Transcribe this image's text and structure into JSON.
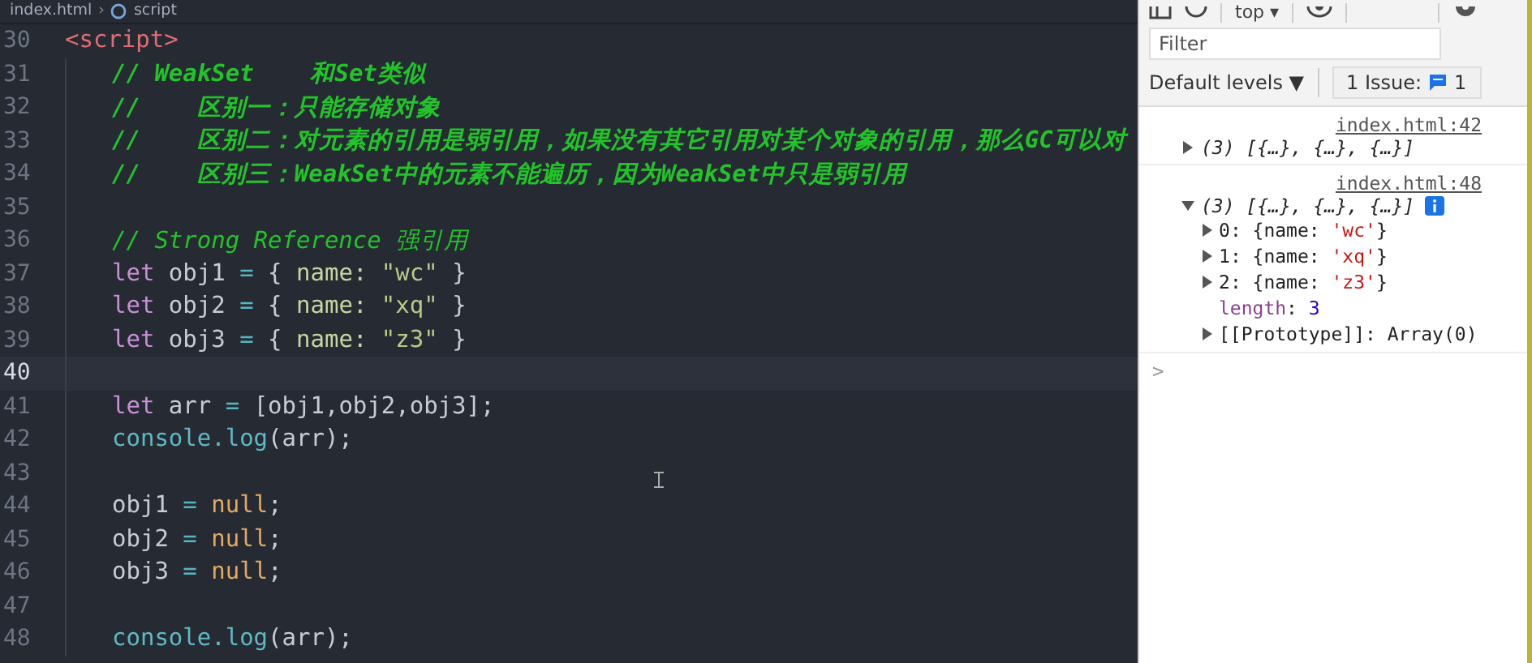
{
  "editor": {
    "breadcrumb": [
      "index.html",
      "script"
    ],
    "breadcrumb_separator": "›",
    "lines": [
      {
        "number": "30",
        "current": false,
        "indented": false,
        "tokens": [
          {
            "kind": "tag",
            "text": "<script>"
          }
        ]
      },
      {
        "number": "31",
        "current": false,
        "indented": true,
        "tokens": [
          {
            "kind": "comment",
            "text": "// WeakSet    和Set类似"
          }
        ]
      },
      {
        "number": "32",
        "current": false,
        "indented": true,
        "tokens": [
          {
            "kind": "comment",
            "text": "//    区别一：只能存储对象"
          }
        ]
      },
      {
        "number": "33",
        "current": false,
        "indented": true,
        "tokens": [
          {
            "kind": "comment",
            "text": "//    区别二：对元素的引用是弱引用，如果没有其它引用对某个对象的引用，那么GC可以对"
          }
        ]
      },
      {
        "number": "34",
        "current": false,
        "indented": true,
        "tokens": [
          {
            "kind": "comment",
            "text": "//    区别三：WeakSet中的元素不能遍历，因为WeakSet中只是弱引用"
          }
        ]
      },
      {
        "number": "35",
        "current": false,
        "indented": true
      },
      {
        "number": "36",
        "current": false,
        "indented": true,
        "tokens": [
          {
            "kind": "comment-italic",
            "text": "// Strong Reference 强引用"
          }
        ]
      },
      {
        "number": "37",
        "current": false,
        "indented": true,
        "tokens": [
          {
            "kind": "keyword",
            "text": "let"
          },
          {
            "kind": "plain",
            "text": " obj1 "
          },
          {
            "kind": "operator",
            "text": "="
          },
          {
            "kind": "plain",
            "text": " { "
          },
          {
            "kind": "property",
            "text": "name: "
          },
          {
            "kind": "string",
            "text": "\"wc\""
          },
          {
            "kind": "plain",
            "text": " }"
          }
        ]
      },
      {
        "number": "38",
        "current": false,
        "indented": true,
        "tokens": [
          {
            "kind": "keyword",
            "text": "let"
          },
          {
            "kind": "plain",
            "text": " obj2 "
          },
          {
            "kind": "operator",
            "text": "="
          },
          {
            "kind": "plain",
            "text": " { "
          },
          {
            "kind": "property",
            "text": "name: "
          },
          {
            "kind": "string",
            "text": "\"xq\""
          },
          {
            "kind": "plain",
            "text": " }"
          }
        ]
      },
      {
        "number": "39",
        "current": false,
        "indented": true,
        "tokens": [
          {
            "kind": "keyword",
            "text": "let"
          },
          {
            "kind": "plain",
            "text": " obj3 "
          },
          {
            "kind": "operator",
            "text": "="
          },
          {
            "kind": "plain",
            "text": " { "
          },
          {
            "kind": "property",
            "text": "name: "
          },
          {
            "kind": "string",
            "text": "\"z3\""
          },
          {
            "kind": "plain",
            "text": " }"
          }
        ]
      },
      {
        "number": "40",
        "current": true,
        "indented": true
      },
      {
        "number": "41",
        "current": false,
        "indented": true,
        "tokens": [
          {
            "kind": "keyword",
            "text": "let"
          },
          {
            "kind": "plain",
            "text": " arr "
          },
          {
            "kind": "operator",
            "text": "="
          },
          {
            "kind": "plain",
            "text": " [obj1,obj2,obj3];"
          }
        ]
      },
      {
        "number": "42",
        "current": false,
        "indented": true,
        "tokens": [
          {
            "kind": "function",
            "text": "console.log"
          },
          {
            "kind": "plain",
            "text": "(arr);"
          }
        ]
      },
      {
        "number": "43",
        "current": false,
        "indented": true
      },
      {
        "number": "44",
        "current": false,
        "indented": true,
        "tokens": [
          {
            "kind": "plain",
            "text": "obj1 "
          },
          {
            "kind": "operator",
            "text": "= "
          },
          {
            "kind": "null",
            "text": "null"
          },
          {
            "kind": "plain",
            "text": ";"
          }
        ]
      },
      {
        "number": "45",
        "current": false,
        "indented": true,
        "tokens": [
          {
            "kind": "plain",
            "text": "obj2 "
          },
          {
            "kind": "operator",
            "text": "= "
          },
          {
            "kind": "null",
            "text": "null"
          },
          {
            "kind": "plain",
            "text": ";"
          }
        ]
      },
      {
        "number": "46",
        "current": false,
        "indented": true,
        "tokens": [
          {
            "kind": "plain",
            "text": "obj3 "
          },
          {
            "kind": "operator",
            "text": "= "
          },
          {
            "kind": "null",
            "text": "null"
          },
          {
            "kind": "plain",
            "text": ";"
          }
        ]
      },
      {
        "number": "47",
        "current": false,
        "indented": true
      },
      {
        "number": "48",
        "current": false,
        "indented": true,
        "tokens": [
          {
            "kind": "function",
            "text": "console.log"
          },
          {
            "kind": "plain",
            "text": "(arr);"
          }
        ]
      }
    ]
  },
  "console": {
    "context": "top ▾",
    "filter": {
      "placeholder": "Filter"
    },
    "levels": "Default levels ▼",
    "issues": {
      "label": "1 Issue:",
      "count": "1"
    },
    "entries": [
      {
        "source": "index.html:42",
        "summary": "(3) [{…}, {…}, {…}]",
        "expanded": false,
        "info": false
      },
      {
        "source": "index.html:48",
        "summary": "(3) [{…}, {…}, {…}]",
        "expanded": true,
        "info": true,
        "children": [
          {
            "key": "0",
            "expandable": true,
            "value": [
              {
                "kind": "plain",
                "text": ": {name: "
              },
              {
                "kind": "string",
                "text": "'wc'"
              },
              {
                "kind": "plain",
                "text": "}"
              }
            ]
          },
          {
            "key": "1",
            "expandable": true,
            "value": [
              {
                "kind": "plain",
                "text": ": {name: "
              },
              {
                "kind": "string",
                "text": "'xq'"
              },
              {
                "kind": "plain",
                "text": "}"
              }
            ]
          },
          {
            "key": "2",
            "expandable": true,
            "value": [
              {
                "kind": "plain",
                "text": ": {name: "
              },
              {
                "kind": "string",
                "text": "'z3'"
              },
              {
                "kind": "plain",
                "text": "}"
              }
            ]
          },
          {
            "key": "length",
            "expandable": false,
            "value": [
              {
                "kind": "plain",
                "text": ": "
              },
              {
                "kind": "number",
                "text": "3"
              }
            ]
          },
          {
            "key": "[[Prototype]]",
            "expandable": true,
            "value": [
              {
                "kind": "plain",
                "text": ": Array(0)"
              }
            ]
          }
        ]
      }
    ],
    "prompt": ">"
  }
}
